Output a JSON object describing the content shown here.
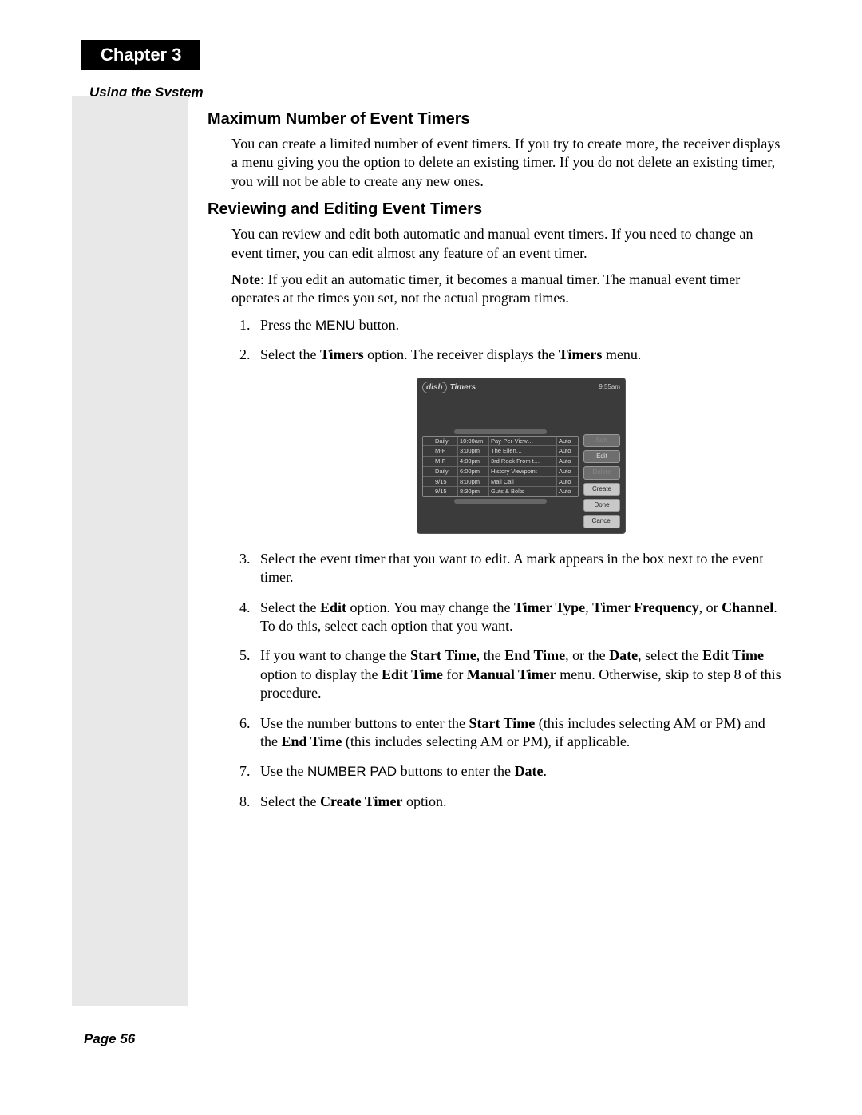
{
  "chapter": "Chapter 3",
  "subtitle": "Using the System",
  "footer": "Page 56",
  "section1": {
    "heading": "Maximum Number of Event Timers",
    "para": "You can create a limited number of event timers. If you try to create more, the receiver displays a menu giving you the option to delete an existing timer. If you do not delete an existing timer, you will not be able to create any new ones."
  },
  "section2": {
    "heading": "Reviewing and Editing Event Timers",
    "para1": "You can review and edit both automatic and manual event timers. If you need to change an event timer, you can edit almost any feature of an event timer.",
    "note_label": "Note",
    "note_rest": ": If you edit an automatic timer, it becomes a manual timer. The manual event timer operates at the times you set, not the actual program times.",
    "step1_a": "Press the ",
    "step1_b": "MENU",
    "step1_c": " button.",
    "step2_a": "Select the ",
    "step2_b": "Timers",
    "step2_c": " option. The receiver displays the ",
    "step2_d": "Timers",
    "step2_e": " menu.",
    "step3": "Select the event timer that you want to edit. A mark appears in the box next to the event timer.",
    "step4_a": "Select the ",
    "step4_b": "Edit",
    "step4_c": " option. You may change the ",
    "step4_d": "Timer Type",
    "step4_e": ", ",
    "step4_f": "Timer Frequency",
    "step4_g": ", or ",
    "step4_h": "Channel",
    "step4_i": ". To do this, select each option that you want.",
    "step5_a": "If you want to change the ",
    "step5_b": "Start Time",
    "step5_c": ", the ",
    "step5_d": "End Time",
    "step5_e": ", or the ",
    "step5_f": "Date",
    "step5_g": ", select the ",
    "step5_h": "Edit Time",
    "step5_i": " option to display the ",
    "step5_j": "Edit Time",
    "step5_k": " for ",
    "step5_l": "Manual Timer",
    "step5_m": " menu. Otherwise, skip to step 8 of this procedure.",
    "step6_a": "Use the number buttons to enter the ",
    "step6_b": "Start Time",
    "step6_c": " (this includes selecting AM or PM) and the ",
    "step6_d": "End Time",
    "step6_e": " (this includes selecting AM or PM), if applicable.",
    "step7_a": "Use the ",
    "step7_b": "NUMBER PAD",
    "step7_c": " buttons to enter the ",
    "step7_d": "Date",
    "step7_e": ".",
    "step8_a": "Select the ",
    "step8_b": "Create Timer",
    "step8_c": " option."
  },
  "tv": {
    "logo": "dish",
    "title": "Timers",
    "clock": "9:55am",
    "rows": [
      {
        "chk": "",
        "freq": "Daily",
        "time": "10:00am",
        "prog": "Pay-Per-View…",
        "type": "Auto"
      },
      {
        "chk": "",
        "freq": "M-F",
        "time": "3:00pm",
        "prog": "The Ellen…",
        "type": "Auto"
      },
      {
        "chk": "",
        "freq": "M-F",
        "time": "4:00pm",
        "prog": "3rd Rock From t…",
        "type": "Auto"
      },
      {
        "chk": "",
        "freq": "Daily",
        "time": "6:00pm",
        "prog": "History Viewpoint",
        "type": "Auto"
      },
      {
        "chk": "",
        "freq": "9/15",
        "time": "8:00pm",
        "prog": "Mail Call",
        "type": "Auto"
      },
      {
        "chk": "",
        "freq": "9/15",
        "time": "8:30pm",
        "prog": "Guts & Bolts",
        "type": "Auto"
      }
    ],
    "buttons": {
      "sort": "Sort",
      "edit": "Edit",
      "delete": "Delete",
      "create": "Create",
      "done": "Done",
      "cancel": "Cancel"
    }
  }
}
